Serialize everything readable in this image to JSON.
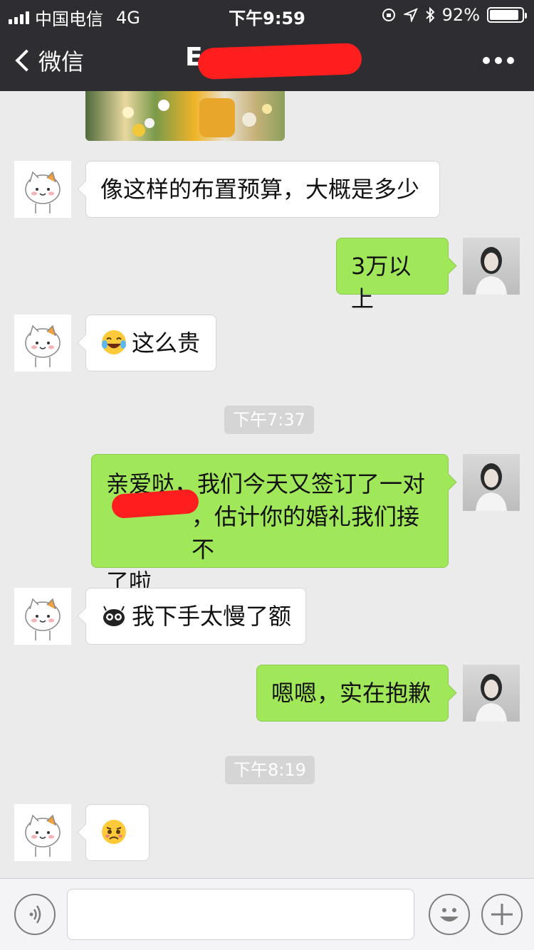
{
  "status_bar": {
    "carrier": "中国电信",
    "network": "4G",
    "time": "下午9:59",
    "battery_percent": "92%",
    "battery_level": 0.92
  },
  "nav": {
    "back_label": "微信",
    "title": "E"
  },
  "messages": [
    {
      "side": "in",
      "text": "像这样的布置预算，大概是多少"
    },
    {
      "side": "out",
      "text": "3万以上"
    },
    {
      "side": "in",
      "emoji": "tears-of-joy-emoji",
      "text": "这么贵"
    },
    {
      "timestamp": "下午7:37"
    },
    {
      "side": "out",
      "lines": [
        "亲爱哒，我们今天又签订了一对",
        "，估计你的婚礼我们接不",
        "了啦"
      ]
    },
    {
      "side": "in",
      "emoji": "black-ghost-emoji",
      "text": "我下手太慢了额"
    },
    {
      "side": "out",
      "text": "嗯嗯，实在抱歉"
    },
    {
      "timestamp": "下午8:19"
    },
    {
      "side": "in",
      "emoji": "pleading-face-emoji",
      "text": ""
    }
  ],
  "colors": {
    "header_bg": "#2e2e32",
    "chat_bg": "#ebebeb",
    "outgoing_bubble": "#a0e75a",
    "incoming_bubble": "#ffffff",
    "redaction": "#ff1e1e"
  },
  "icons": [
    "voice-icon",
    "emoji-icon",
    "plus-icon",
    "more-icon",
    "back-chevron-icon"
  ]
}
